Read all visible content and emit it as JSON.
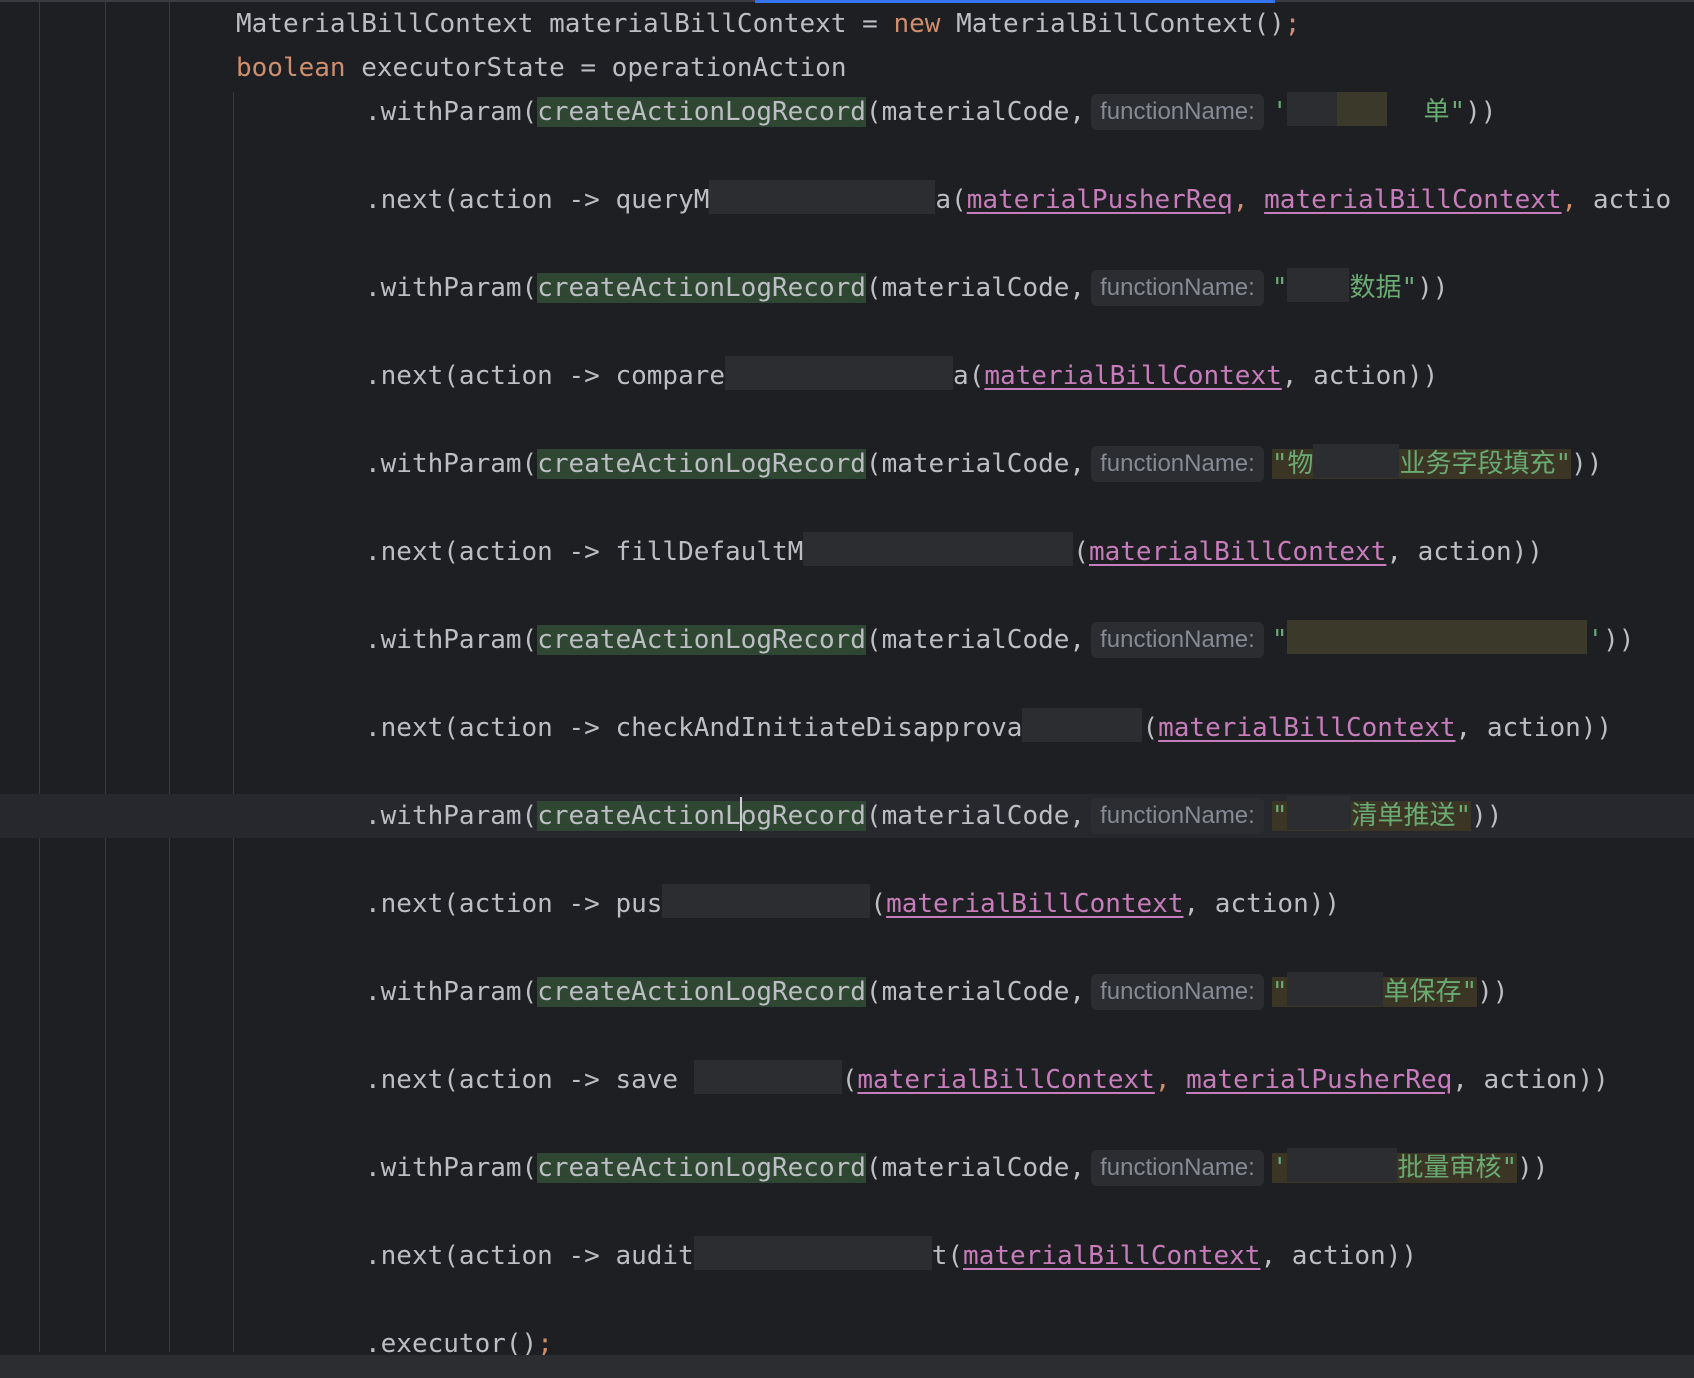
{
  "editor": {
    "line1": {
      "type": "MaterialBillContext",
      "var": " materialBillContext = ",
      "kw": "new",
      "call": " MaterialBillContext()",
      "semi": ";"
    },
    "line2": {
      "kw": "boolean",
      "rest": " executorState = operationAction"
    },
    "with_param_prefix": ".withParam(",
    "create_fn": "createActionLogRecord",
    "create_fn_a": "createActionL",
    "create_fn_b": "ogRecord",
    "material_code": "(materialCode,",
    "hint_label": "functionName:",
    "close2": "))",
    "next_prefix": ".next(action -> ",
    "args_ctx_action": ", action))",
    "comma": ", ",
    "open_paren": "(",
    "ref_req": "materialPusherReq",
    "ref_ctx": "materialBillContext",
    "rows": {
      "r1_str_start": "'",
      "r1_str_end": "单\"",
      "n1_name": "queryM",
      "n1_tail": "a",
      "n1_trail": "actio",
      "r2_str_start": "\"",
      "r2_str_end": "数据\"",
      "n2_name": "compare",
      "n2_tail": "a",
      "r3_str_start": "\"物",
      "r3_str_end": "业务字段填充\"",
      "n3_name": "fillDefaultM",
      "r4_str_start": "\"",
      "r4_str_end": "'",
      "n4_name": "checkAndInitiateDisapprova",
      "r5_str_start": "\"",
      "r5_str_end": "清单推送\"",
      "n5_name": "pus",
      "r6_str_start": "\"",
      "r6_str_end": "单保存\"",
      "n6_name": "save ",
      "r7_str_start": "'",
      "r7_str_end": "批量审核\"",
      "n7_name": "audit",
      "n7_tail": "t"
    },
    "executor": ".executor()",
    "executor_semi": ";"
  },
  "colors": {
    "background": "#1e1f22",
    "keyword": "#cf8e6d",
    "string": "#6aab73",
    "reference": "#c77dbb",
    "highlight": "#2f4632",
    "hint": "#858a93"
  }
}
